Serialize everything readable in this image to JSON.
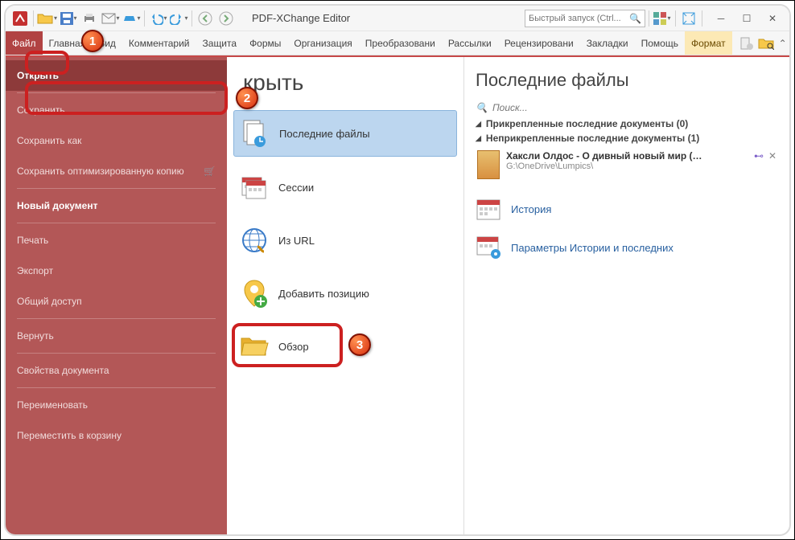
{
  "app_title": "PDF-XChange Editor",
  "quick_search_placeholder": "Быстрый запуск (Ctrl...",
  "ribbon_tabs": [
    "Файл",
    "Главная",
    "Вид",
    "Комментарий",
    "Защита",
    "Формы",
    "Организация",
    "Преобразовани",
    "Рассылки",
    "Рецензировани",
    "Закладки",
    "Помощь",
    "Формат"
  ],
  "file_menu": {
    "open": "Открыть",
    "save": "Сохранить",
    "save_as": "Сохранить как",
    "save_opt": "Сохранить оптимизированную копию",
    "new_doc": "Новый документ",
    "print": "Печать",
    "export": "Экспорт",
    "share": "Общий доступ",
    "revert": "Вернуть",
    "props": "Свойства документа",
    "rename": "Переименовать",
    "trash": "Переместить в корзину"
  },
  "mid": {
    "title": "крыть",
    "recent": "Последние файлы",
    "sessions": "Сессии",
    "from_url": "Из URL",
    "add_loc": "Добавить позицию",
    "browse": "Обзор"
  },
  "right": {
    "title": "Последние файлы",
    "search_ph": "Поиск...",
    "pinned": "Прикрепленные последние документы (0)",
    "unpinned": "Неприкрепленные последние документы (1)",
    "file_name": "Хаксли Олдос - О дивный новый мир (Экскл...",
    "file_path": "G:\\OneDrive\\Lumpics\\",
    "history": "История",
    "params": "Параметры Истории и последних"
  },
  "badges": {
    "b1": "1",
    "b2": "2",
    "b3": "3"
  }
}
